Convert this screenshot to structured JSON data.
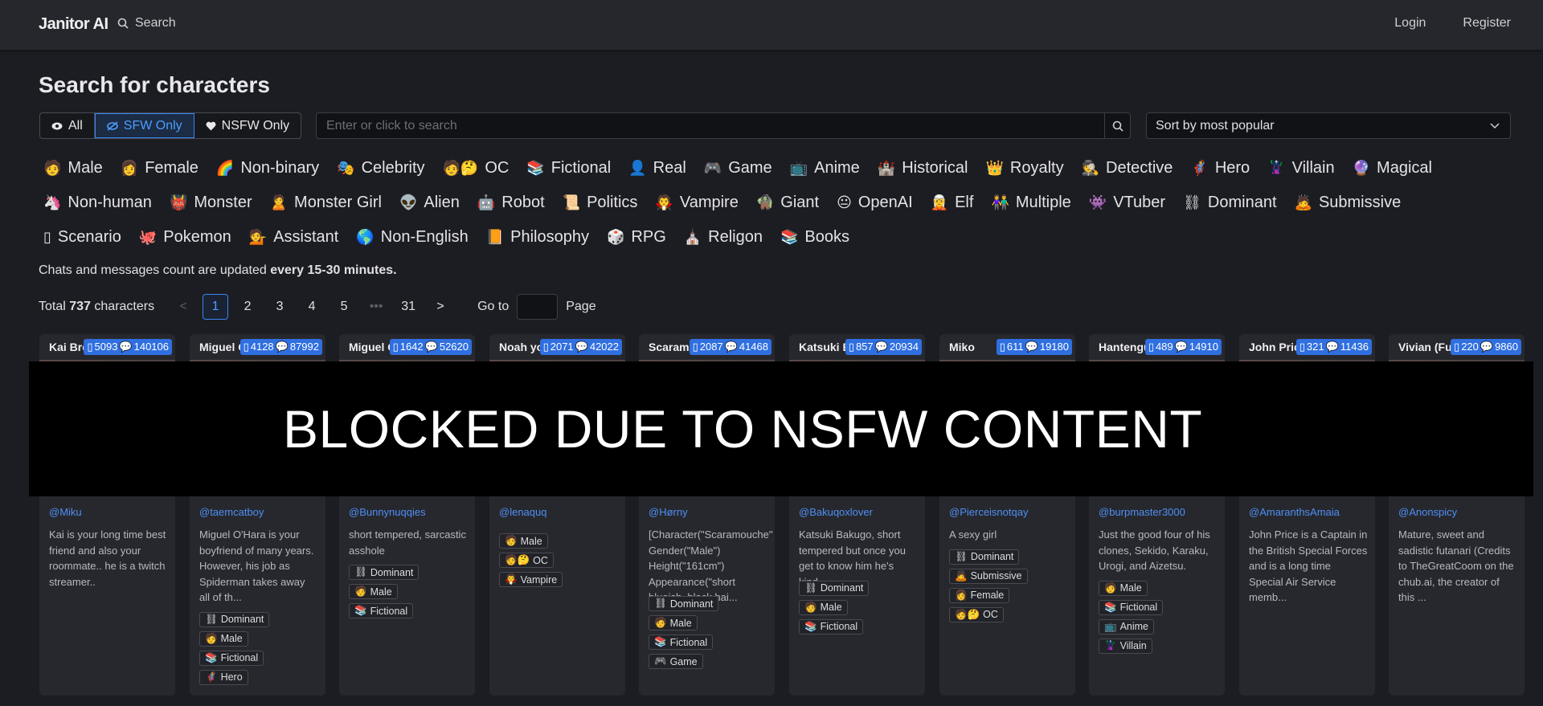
{
  "header": {
    "logo": "Janitor AI",
    "search_label": "Search",
    "login": "Login",
    "register": "Register"
  },
  "page_title": "Search for characters",
  "filters": [
    {
      "label": "All",
      "icon": "eye-icon",
      "active": false
    },
    {
      "label": "SFW Only",
      "icon": "eye-slash-icon",
      "active": true
    },
    {
      "label": "NSFW Only",
      "icon": "heart-icon",
      "active": false
    }
  ],
  "search": {
    "placeholder": "Enter or click to search"
  },
  "sort": {
    "label": "Sort by most popular"
  },
  "tag_rows": [
    [
      {
        "icon": "🧑",
        "label": "Male"
      },
      {
        "icon": "👩",
        "label": "Female"
      },
      {
        "icon": "🌈",
        "label": "Non-binary"
      },
      {
        "icon": "🎭",
        "label": "Celebrity"
      },
      {
        "icon": "🧑🤔",
        "label": "OC"
      },
      {
        "icon": "📚",
        "label": "Fictional"
      },
      {
        "icon": "👤",
        "label": "Real"
      },
      {
        "icon": "🎮",
        "label": "Game"
      },
      {
        "icon": "📺",
        "label": "Anime"
      },
      {
        "icon": "🏰",
        "label": "Historical"
      },
      {
        "icon": "👑",
        "label": "Royalty"
      },
      {
        "icon": "🕵",
        "label": "Detective"
      },
      {
        "icon": "🦸",
        "label": "Hero"
      },
      {
        "icon": "🦹",
        "label": "Villain"
      },
      {
        "icon": "🔮",
        "label": "Magical"
      }
    ],
    [
      {
        "icon": "🦄",
        "label": "Non-human"
      },
      {
        "icon": "👹",
        "label": "Monster"
      },
      {
        "icon": "🙎",
        "label": "Monster Girl"
      },
      {
        "icon": "👽",
        "label": "Alien"
      },
      {
        "icon": "🤖",
        "label": "Robot"
      },
      {
        "icon": "📜",
        "label": "Politics"
      },
      {
        "icon": "🧛",
        "label": "Vampire"
      },
      {
        "icon": "🧌",
        "label": "Giant"
      },
      {
        "icon": "😐",
        "label": "OpenAI"
      },
      {
        "icon": "🧝",
        "label": "Elf"
      },
      {
        "icon": "👫",
        "label": "Multiple"
      },
      {
        "icon": "👾",
        "label": "VTuber"
      },
      {
        "icon": "⛓",
        "label": "Dominant"
      },
      {
        "icon": "🙇",
        "label": "Submissive"
      }
    ],
    [
      {
        "icon": "▯",
        "label": "Scenario"
      },
      {
        "icon": "🐙",
        "label": "Pokemon"
      },
      {
        "icon": "💁",
        "label": "Assistant"
      },
      {
        "icon": "🌎",
        "label": "Non-English"
      },
      {
        "icon": "📙",
        "label": "Philosophy"
      },
      {
        "icon": "🎲",
        "label": "RPG"
      },
      {
        "icon": "⛪",
        "label": "Religon"
      },
      {
        "icon": "📚",
        "label": "Books"
      }
    ]
  ],
  "note": {
    "prefix": "Chats and messages count are updated ",
    "bold": "every 15-30 minutes."
  },
  "pagination": {
    "total_prefix": "Total ",
    "total_count": "737",
    "total_suffix": " characters",
    "prev": "<",
    "pages": [
      "1",
      "2",
      "3",
      "4",
      "5"
    ],
    "ellipsis": "•••",
    "last": "31",
    "next": ">",
    "goto_label": "Go to",
    "page_label": "Page",
    "current": "1"
  },
  "cards": [
    {
      "name": "Kai Brown",
      "chats": "5093",
      "messages": "140106",
      "author": "@Miku",
      "desc": "Kai is your long time best friend and also your roommate.. he is a twitch streamer..",
      "tags": []
    },
    {
      "name": "Miguel O'Hara",
      "chats": "4128",
      "messages": "87992",
      "author": "@taemcatboy",
      "desc": "Miguel O'Hara is your boyfriend of many years. However, his job as Spiderman takes away all of th...",
      "tags": [
        {
          "icon": "⛓",
          "label": "Dominant"
        },
        {
          "icon": "🧑",
          "label": "Male"
        },
        {
          "icon": "📚",
          "label": "Fictional"
        },
        {
          "icon": "🦸",
          "label": "Hero"
        }
      ]
    },
    {
      "name": "Miguel O'Hara",
      "chats": "1642",
      "messages": "52620",
      "author": "@Bunnynuqqies",
      "desc": "short tempered, sarcastic asshole",
      "tags": [
        {
          "icon": "⛓",
          "label": "Dominant"
        },
        {
          "icon": "🧑",
          "label": "Male"
        },
        {
          "icon": "📚",
          "label": "Fictional"
        }
      ]
    },
    {
      "name": "Noah your",
      "chats": "2071",
      "messages": "42022",
      "author": "@lenaquq",
      "desc": "",
      "tags": [
        {
          "icon": "🧑",
          "label": "Male"
        },
        {
          "icon": "🧑🤔",
          "label": "OC"
        },
        {
          "icon": "🧛",
          "label": "Vampire"
        }
      ]
    },
    {
      "name": "Scaramouche",
      "chats": "2087",
      "messages": "41468",
      "author": "@Hørny",
      "desc": "[Character(\"Scaramouche\" Gender(\"Male\") Height(\"161cm\") Appearance(\"short blueish, black hai...",
      "tags": [
        {
          "icon": "⛓",
          "label": "Dominant"
        },
        {
          "icon": "🧑",
          "label": "Male"
        },
        {
          "icon": "📚",
          "label": "Fictional"
        },
        {
          "icon": "🎮",
          "label": "Game"
        }
      ]
    },
    {
      "name": "Katsuki Bakugo",
      "chats": "857",
      "messages": "20934",
      "author": "@Bakuqoxlover",
      "desc": "Katsuki Bakugo, short tempered but once you get to know him he's kind.",
      "tags": [
        {
          "icon": "⛓",
          "label": "Dominant"
        },
        {
          "icon": "🧑",
          "label": "Male"
        },
        {
          "icon": "📚",
          "label": "Fictional"
        }
      ]
    },
    {
      "name": "Miko",
      "chats": "611",
      "messages": "19180",
      "author": "@Pierceisnotqay",
      "desc": "A sexy girl",
      "tags": [
        {
          "icon": "⛓",
          "label": "Dominant"
        },
        {
          "icon": "🙇",
          "label": "Submissive"
        },
        {
          "icon": "👩",
          "label": "Female"
        },
        {
          "icon": "🧑🤔",
          "label": "OC"
        }
      ]
    },
    {
      "name": "Hantengu Clones",
      "chats": "489",
      "messages": "14910",
      "author": "@burpmaster3000",
      "desc": "Just the good four of his clones, Sekido, Karaku, Urogi, and Aizetsu.",
      "tags": [
        {
          "icon": "🧑",
          "label": "Male"
        },
        {
          "icon": "📚",
          "label": "Fictional"
        },
        {
          "icon": "📺",
          "label": "Anime"
        },
        {
          "icon": "🦹",
          "label": "Villain"
        }
      ]
    },
    {
      "name": "John Price",
      "chats": "321",
      "messages": "11436",
      "author": "@AmaranthsAmaia",
      "desc": "John Price is a Captain in the British Special Forces and is a long time Special Air Service memb...",
      "tags": []
    },
    {
      "name": "Vivian (Futanari)",
      "chats": "220",
      "messages": "9860",
      "author": "@Anonspicy",
      "desc": "Mature, sweet and sadistic futanari (Credits to TheGreatCoom on the chub.ai, the creator of this ...",
      "tags": []
    }
  ],
  "overlay": "BLOCKED DUE TO NSFW CONTENT"
}
